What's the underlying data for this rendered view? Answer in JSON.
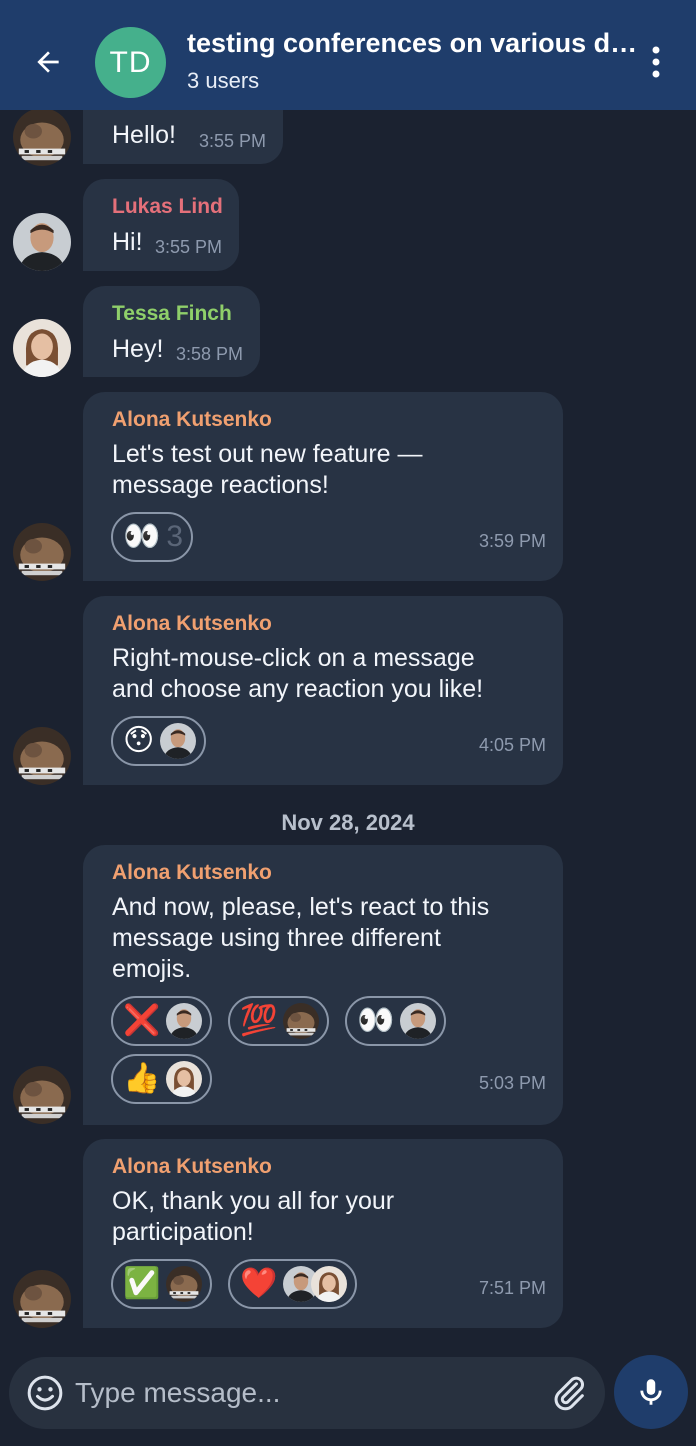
{
  "header": {
    "avatar_initials": "TD",
    "title": "testing conferences on various devi...",
    "subtitle": "3 users"
  },
  "date_separator": "Nov 28, 2024",
  "messages": [
    {
      "sender": "",
      "text": "Hello!",
      "time": "3:55 PM"
    },
    {
      "sender": "Lukas Lind",
      "text": "Hi!",
      "time": "3:55 PM"
    },
    {
      "sender": "Tessa Finch",
      "text": "Hey!",
      "time": "3:58 PM"
    },
    {
      "sender": "Alona Kutsenko",
      "text": "Let's test out new feature —\nmessage reactions!",
      "time": "3:59 PM",
      "reactions": [
        {
          "emoji": "👀",
          "count": "3"
        }
      ]
    },
    {
      "sender": "Alona Kutsenko",
      "text": "Right-mouse-click on a message\nand choose any reaction you like!",
      "time": "4:05 PM",
      "reactions": [
        {
          "emoji": "😯"
        }
      ]
    },
    {
      "sender": "Alona Kutsenko",
      "text": "And now, please, let's react to this\nmessage using three different\nemojis.",
      "time": "5:03 PM",
      "reactions": [
        {
          "emoji": "❌"
        },
        {
          "emoji": "💯"
        },
        {
          "emoji": "👀"
        },
        {
          "emoji": "👍"
        }
      ]
    },
    {
      "sender": "Alona Kutsenko",
      "text": "OK, thank you all for your\nparticipation!",
      "time": "7:51 PM",
      "reactions": [
        {
          "emoji": "✅"
        },
        {
          "emoji": "❤️"
        }
      ]
    }
  ],
  "composer": {
    "placeholder": "Type message..."
  },
  "colors": {
    "header_bg": "#1f3d6b",
    "background": "#1b2230",
    "bubble": "#283344",
    "sender_lukas": "#e4707a",
    "sender_tessa": "#8fcf6a",
    "sender_alona": "#f0a070"
  },
  "icons": {
    "back": "arrow-left-icon",
    "menu": "more-vertical-icon",
    "emoji": "smiley-icon",
    "attach": "paperclip-icon",
    "mic": "microphone-icon"
  }
}
